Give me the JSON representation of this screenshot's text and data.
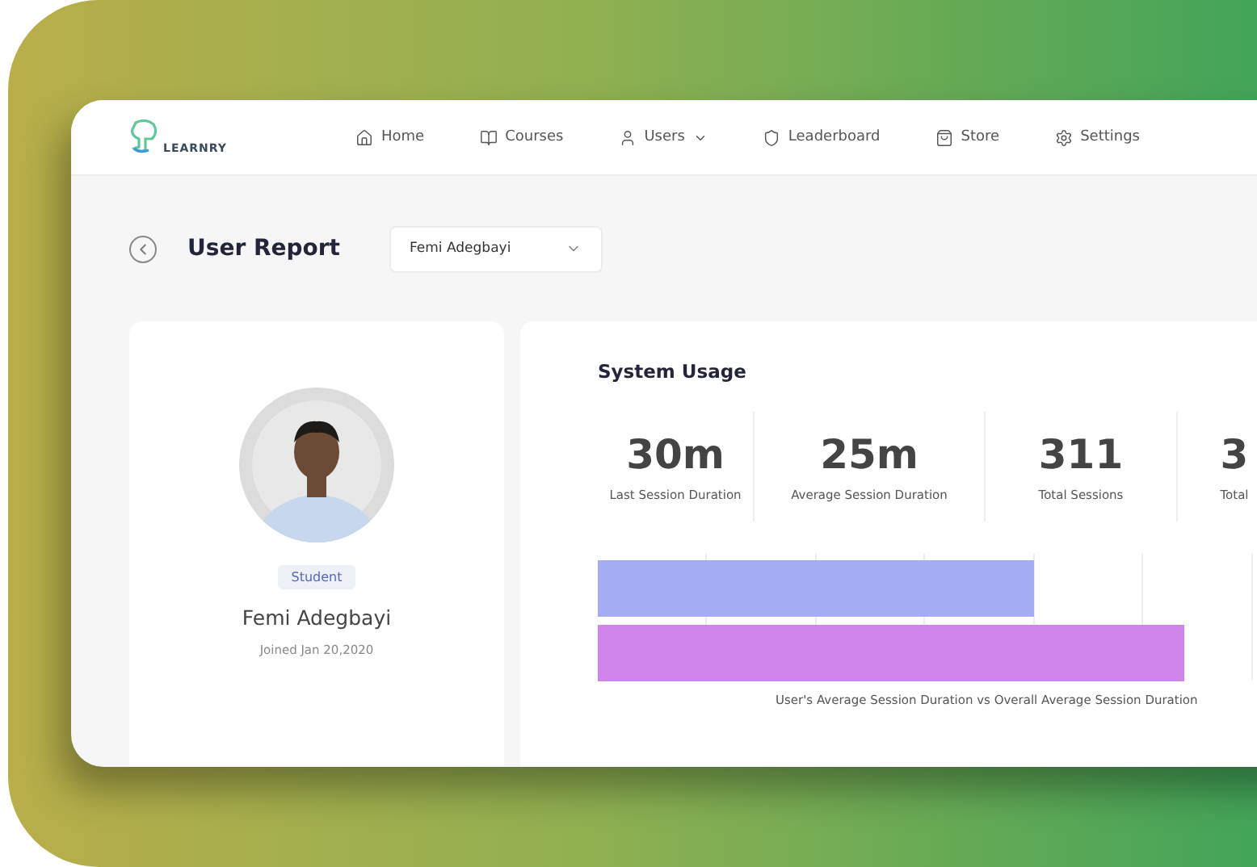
{
  "nav": {
    "logo": "LEARNRY",
    "items": [
      {
        "label": "Home",
        "kind": "link"
      },
      {
        "label": "Courses",
        "kind": "link"
      },
      {
        "label": "Users",
        "kind": "dropdown"
      },
      {
        "label": "Leaderboard",
        "kind": "link"
      },
      {
        "label": "Store",
        "kind": "link"
      },
      {
        "label": "Settings",
        "kind": "link"
      }
    ]
  },
  "header": {
    "title": "User Report",
    "select": {
      "value": "Femi Adegbayi"
    }
  },
  "profile": {
    "role": "Student",
    "name": "Femi Adegbayi",
    "joined": "Joined Jan 20,2020"
  },
  "usage": {
    "title": "System Usage",
    "stats": [
      {
        "value": "30m",
        "label": "Last Session Duration"
      },
      {
        "value": "25m",
        "label": "Average Session Duration"
      },
      {
        "value": "311",
        "label": "Total Sessions"
      },
      {
        "value": "3",
        "label": "Total"
      }
    ],
    "chart": {
      "caption": "User's Average Session Duration vs Overall Average Session Duration"
    }
  }
}
